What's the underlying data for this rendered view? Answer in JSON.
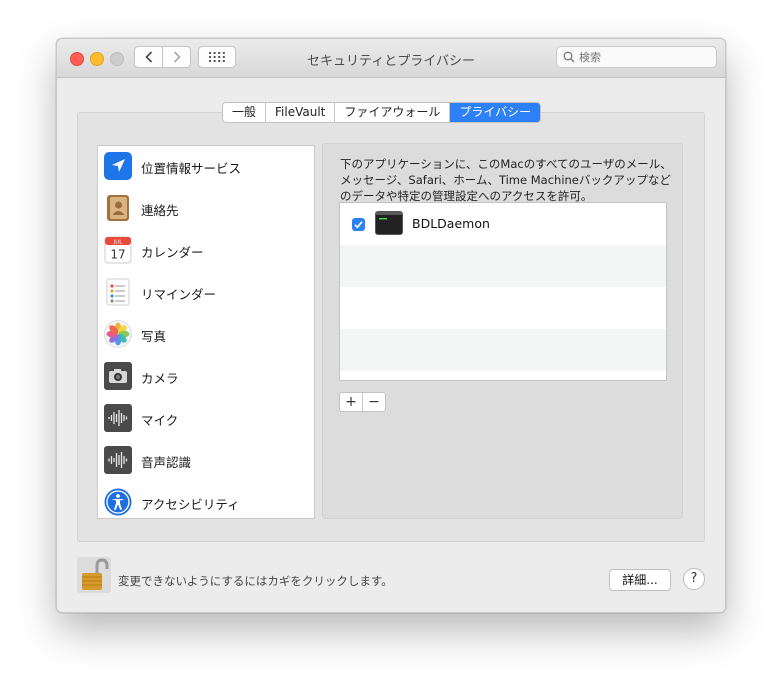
{
  "window": {
    "title": "セキュリティとプライバシー"
  },
  "search": {
    "placeholder": "検索"
  },
  "tabs": [
    {
      "label": "一般",
      "active": false
    },
    {
      "label": "FileVault",
      "active": false
    },
    {
      "label": "ファイアウォール",
      "active": false
    },
    {
      "label": "プライバシー",
      "active": true
    }
  ],
  "sidebar": {
    "items": [
      {
        "label": "位置情報サービス",
        "icon": "location-arrow-icon"
      },
      {
        "label": "連絡先",
        "icon": "contacts-book-icon"
      },
      {
        "label": "カレンダー",
        "icon": "calendar-icon",
        "calendar_month": "JUL",
        "calendar_day": "17"
      },
      {
        "label": "リマインダー",
        "icon": "reminders-list-icon"
      },
      {
        "label": "写真",
        "icon": "photos-flower-icon"
      },
      {
        "label": "カメラ",
        "icon": "camera-icon"
      },
      {
        "label": "マイク",
        "icon": "microphone-waveform-icon"
      },
      {
        "label": "音声認識",
        "icon": "speech-recognition-waveform-icon"
      },
      {
        "label": "アクセシビリティ",
        "icon": "accessibility-icon"
      }
    ]
  },
  "main": {
    "description": "下のアプリケーションに、このMacのすべてのユーザのメール、メッセージ、Safari、ホーム、Time Machineバックアップなどのデータや特定の管理設定へのアクセスを許可。",
    "apps": [
      {
        "name": "BDLDaemon",
        "checked": true,
        "icon": "terminal-icon"
      }
    ],
    "add_label": "+",
    "remove_label": "−"
  },
  "footer": {
    "lock_text": "変更できないようにするにはカギをクリックします。",
    "details_label": "詳細...",
    "help_label": "?"
  },
  "colors": {
    "accent": "#2d80f5",
    "close": "#ff5f57",
    "minimize": "#febc2e",
    "zoom": "#cdcdcd"
  }
}
